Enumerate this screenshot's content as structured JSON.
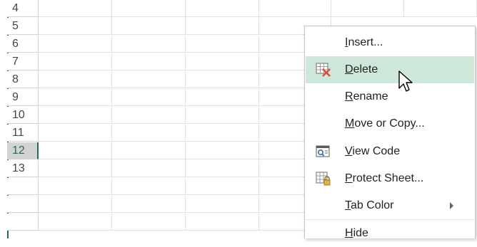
{
  "sheet": {
    "rows": [
      "4",
      "5",
      "6",
      "7",
      "8",
      "9",
      "10",
      "11",
      "12",
      "13"
    ],
    "selected_row": "12"
  },
  "menu": {
    "items": [
      {
        "pre": "",
        "key": "I",
        "post": "nsert...",
        "icon": null
      },
      {
        "pre": "",
        "key": "D",
        "post": "elete",
        "icon": "delete-sheet-icon"
      },
      {
        "pre": "",
        "key": "R",
        "post": "ename",
        "icon": null
      },
      {
        "pre": "",
        "key": "M",
        "post": "ove or Copy...",
        "icon": null
      },
      {
        "pre": "",
        "key": "V",
        "post": "iew Code",
        "icon": "view-code-icon"
      },
      {
        "pre": "",
        "key": "P",
        "post": "rotect Sheet...",
        "icon": "protect-sheet-icon"
      },
      {
        "pre": "",
        "key": "T",
        "post": "ab Color",
        "icon": null,
        "submenu": true
      },
      {
        "pre": "",
        "key": "H",
        "post": "ide",
        "icon": null
      }
    ],
    "hovered_item": "Delete"
  },
  "colors": {
    "accent_green": "#217346",
    "hover_bg": "#cde8d9",
    "delete_x_red": "#e04a2f"
  }
}
